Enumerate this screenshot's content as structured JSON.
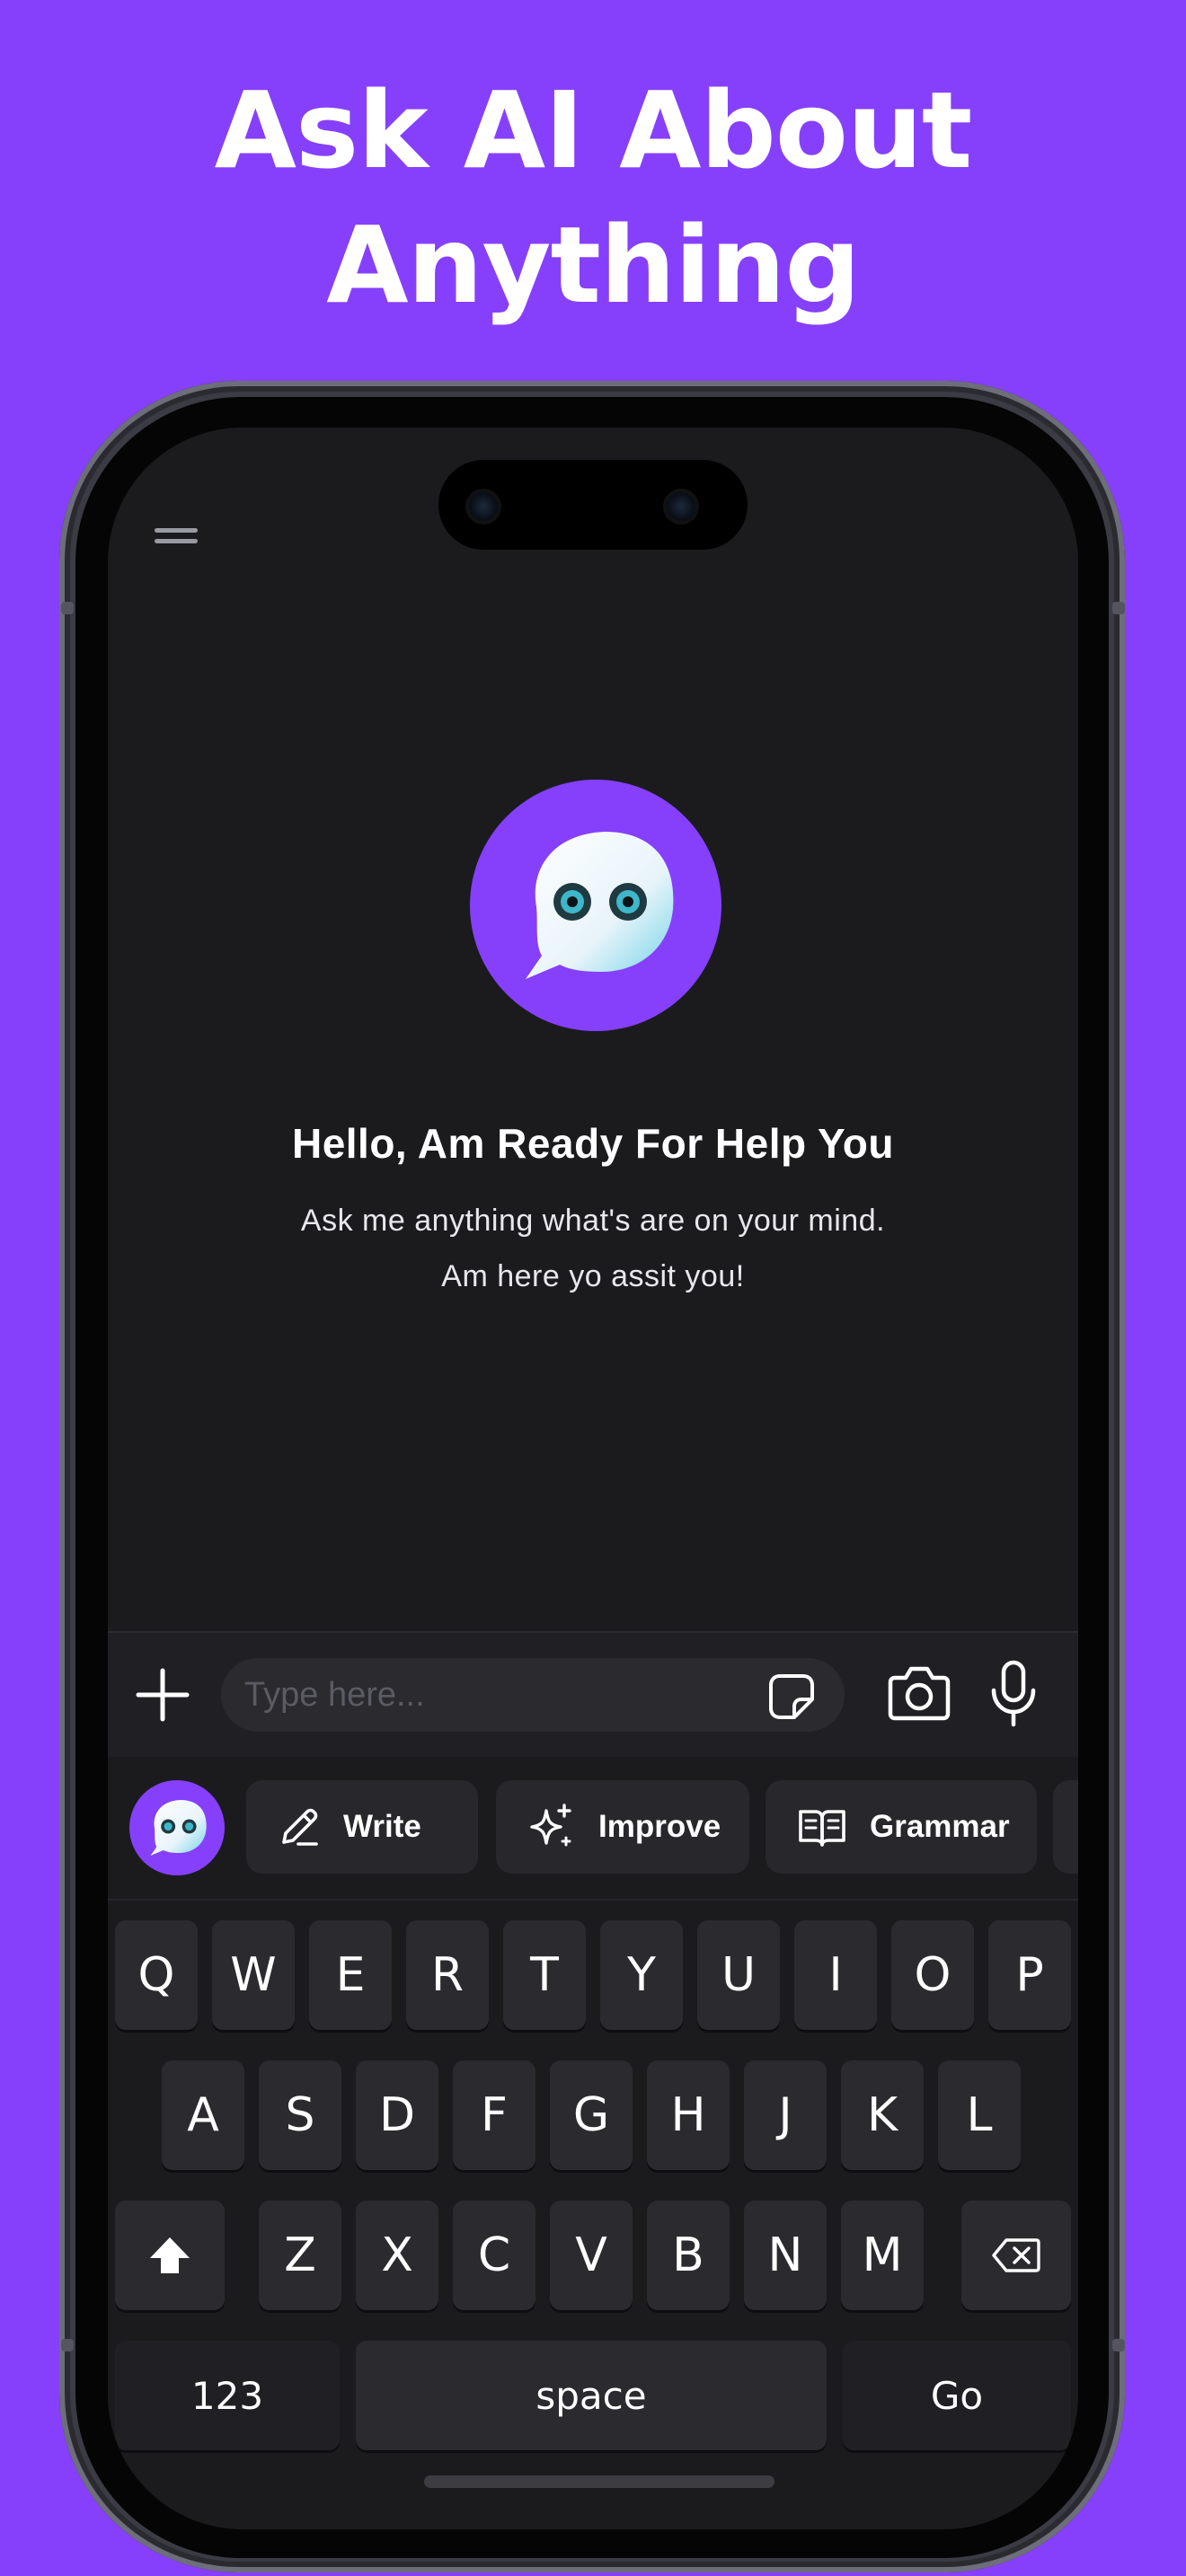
{
  "headline": {
    "line1": "Ask AI About",
    "line2": "Anything"
  },
  "colors": {
    "brand": "#8640fc",
    "screen": "#1b1b1e",
    "key": "#2b2b2f"
  },
  "icons": [
    "menu-icon",
    "bot-icon",
    "plus-icon",
    "sticker-icon",
    "camera-icon",
    "mic-icon",
    "pencil-icon",
    "sparkle-icon",
    "book-icon",
    "shift-icon",
    "backspace-icon"
  ],
  "welcome": {
    "title": "Hello, Am Ready For Help You",
    "line1": "Ask me anything what's are on your mind.",
    "line2": "Am here yo assit you!"
  },
  "input": {
    "placeholder": "Type here..."
  },
  "chips": [
    {
      "label": "Write",
      "icon": "pencil-icon"
    },
    {
      "label": "Improve",
      "icon": "sparkle-icon"
    },
    {
      "label": "Grammar",
      "icon": "book-icon"
    }
  ],
  "keyboard": {
    "row1": [
      "Q",
      "W",
      "E",
      "R",
      "T",
      "Y",
      "U",
      "I",
      "O",
      "P"
    ],
    "row2": [
      "A",
      "S",
      "D",
      "F",
      "G",
      "H",
      "J",
      "K",
      "L"
    ],
    "row3": [
      "Z",
      "X",
      "C",
      "V",
      "B",
      "N",
      "M"
    ],
    "numbers": "123",
    "space": "space",
    "go": "Go"
  }
}
